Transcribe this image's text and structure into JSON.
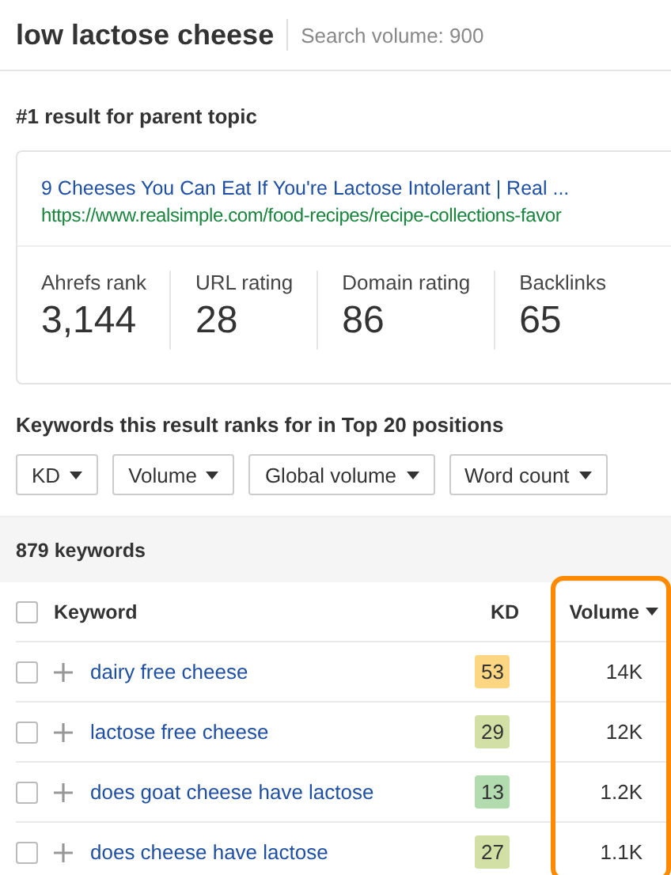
{
  "header": {
    "title": "low lactose cheese",
    "search_volume": "Search volume: 900"
  },
  "parent_topic": {
    "heading": "#1 result for parent topic",
    "result_title": "9 Cheeses You Can Eat If You're Lactose Intolerant | Real ...",
    "result_url": "https://www.realsimple.com/food-recipes/recipe-collections-favor",
    "stats": [
      {
        "label": "Ahrefs rank",
        "value": "3,144"
      },
      {
        "label": "URL rating",
        "value": "28"
      },
      {
        "label": "Domain rating",
        "value": "86"
      },
      {
        "label": "Backlinks",
        "value": "65"
      }
    ]
  },
  "keywords_section": {
    "heading": "Keywords this result ranks for in Top 20 positions",
    "filters": [
      "KD",
      "Volume",
      "Global volume",
      "Word count"
    ],
    "count": "879 keywords"
  },
  "table": {
    "select_all_checked": false,
    "columns": [
      {
        "label": "Keyword",
        "highlighted": false
      },
      {
        "label": "KD",
        "highlighted": false
      },
      {
        "label": "Volume",
        "highlighted": true
      }
    ],
    "rows": [
      {
        "keyword": "dairy free cheese",
        "kd": "53",
        "color": "#fcd683",
        "volume": "14K",
        "checked": false
      },
      {
        "keyword": "lactose free cheese",
        "kd": "29",
        "color": "#d2e0a5",
        "volume": "12K",
        "checked": false
      },
      {
        "keyword": "does goat cheese have lactose",
        "kd": "13",
        "color": "#b2dcb0",
        "volume": "1.2K",
        "checked": false
      },
      {
        "keyword": "does cheese have lactose",
        "kd": "27",
        "color": "#d2e0a5",
        "volume": "1.1K",
        "checked": false
      }
    ]
  }
}
